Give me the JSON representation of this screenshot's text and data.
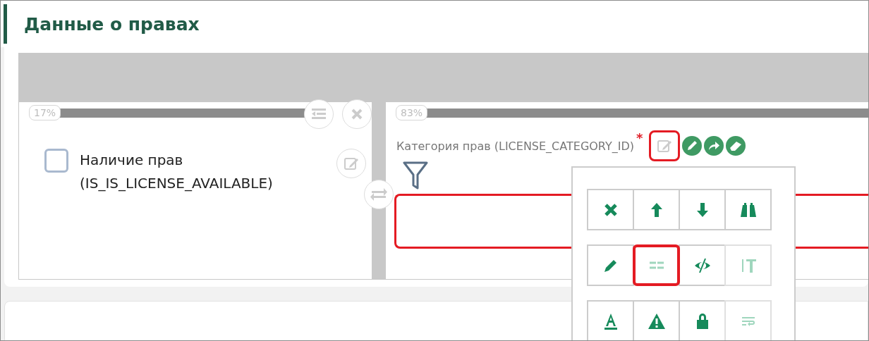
{
  "section": {
    "title": "Данные о правах"
  },
  "columns": [
    {
      "percent": "17%"
    },
    {
      "percent": "83%"
    }
  ],
  "left_field": {
    "label": "Наличие прав (IS_IS_LICENSE_AVAILABLE)",
    "checked": false
  },
  "right_field": {
    "label": "Категория прав (LICENSE_CATEGORY_ID)",
    "required_mark": "*",
    "invalid": true,
    "edit_highlighted": true
  },
  "menu_rows": [
    [
      {
        "kind": "delete",
        "faded": false,
        "highlighted": false
      },
      {
        "kind": "up",
        "faded": false,
        "highlighted": false
      },
      {
        "kind": "down",
        "faded": false,
        "highlighted": false
      },
      {
        "kind": "search",
        "faded": false,
        "highlighted": false
      }
    ],
    [
      {
        "kind": "edit",
        "faded": false,
        "highlighted": false
      },
      {
        "kind": "list",
        "faded": true,
        "highlighted": true
      },
      {
        "kind": "visibility",
        "faded": false,
        "highlighted": false
      },
      {
        "kind": "textsize",
        "faded": true,
        "highlighted": false
      }
    ],
    [
      {
        "kind": "underline",
        "faded": false,
        "highlighted": false
      },
      {
        "kind": "warning",
        "faded": false,
        "highlighted": false
      },
      {
        "kind": "lock",
        "faded": false,
        "highlighted": false
      },
      {
        "kind": "wrap",
        "faded": true,
        "highlighted": false
      }
    ]
  ]
}
